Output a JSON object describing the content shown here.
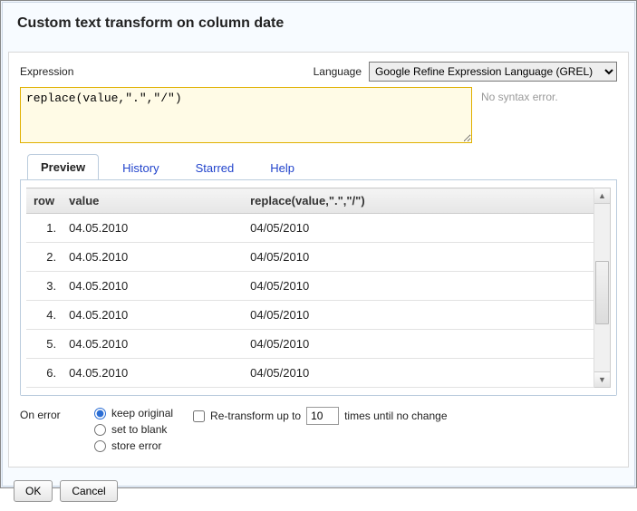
{
  "title": "Custom text transform on column date",
  "labels": {
    "expression": "Expression",
    "language": "Language",
    "on_error": "On error",
    "retransform_prefix": "Re-transform up to",
    "retransform_suffix": "times until no change"
  },
  "language": {
    "selected": "Google Refine Expression Language (GREL)"
  },
  "expression_value": "replace(value,\".\",\"/\")",
  "status_text": "No syntax error.",
  "tabs": {
    "preview": "Preview",
    "history": "History",
    "starred": "Starred",
    "help": "Help"
  },
  "preview": {
    "headers": {
      "row": "row",
      "value": "value",
      "result": "replace(value,\".\",\"/\")"
    },
    "rows": [
      {
        "n": "1.",
        "value": "04.05.2010",
        "result": "04/05/2010"
      },
      {
        "n": "2.",
        "value": "04.05.2010",
        "result": "04/05/2010"
      },
      {
        "n": "3.",
        "value": "04.05.2010",
        "result": "04/05/2010"
      },
      {
        "n": "4.",
        "value": "04.05.2010",
        "result": "04/05/2010"
      },
      {
        "n": "5.",
        "value": "04.05.2010",
        "result": "04/05/2010"
      },
      {
        "n": "6.",
        "value": "04.05.2010",
        "result": "04/05/2010"
      }
    ]
  },
  "on_error_options": {
    "keep_original": "keep original",
    "set_to_blank": "set to blank",
    "store_error": "store error"
  },
  "retransform_value": "10",
  "buttons": {
    "ok": "OK",
    "cancel": "Cancel"
  }
}
